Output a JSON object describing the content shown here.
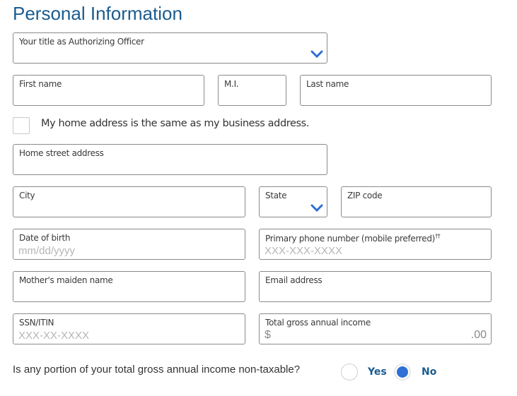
{
  "page": {
    "title": "Personal Information"
  },
  "fields": {
    "officer_title": {
      "label": "Your title as Authorizing Officer",
      "value": ""
    },
    "first_name": {
      "label": "First name",
      "value": ""
    },
    "middle_initial": {
      "label": "M.I.",
      "value": ""
    },
    "last_name": {
      "label": "Last name",
      "value": ""
    },
    "home_street": {
      "label": "Home street address",
      "value": ""
    },
    "city": {
      "label": "City",
      "value": ""
    },
    "state": {
      "label": "State",
      "value": ""
    },
    "zip": {
      "label": "ZIP code",
      "value": ""
    },
    "dob": {
      "label": "Date of birth",
      "placeholder": "mm/dd/yyyy"
    },
    "phone": {
      "label": "Primary phone number (mobile preferred)",
      "label_sup": "††",
      "placeholder": "XXX-XXX-XXXX"
    },
    "maiden_name": {
      "label": "Mother's maiden name",
      "value": ""
    },
    "email": {
      "label": "Email address",
      "value": ""
    },
    "ssn": {
      "label": "SSN/ITIN",
      "placeholder": "XXX-XX-XXXX"
    },
    "income": {
      "label": "Total gross annual income",
      "currency_symbol": "$",
      "cents": ".00"
    }
  },
  "same_address": {
    "label": "My home address is the same as my business address.",
    "checked": false
  },
  "nontaxable": {
    "question": "Is any portion of your total gross annual income non-taxable?",
    "options": [
      {
        "label": "Yes",
        "selected": false
      },
      {
        "label": "No",
        "selected": true
      }
    ]
  },
  "colors": {
    "title": "#1b5c8f",
    "accent": "#2f6fd6",
    "border": "#8a8a8a"
  }
}
